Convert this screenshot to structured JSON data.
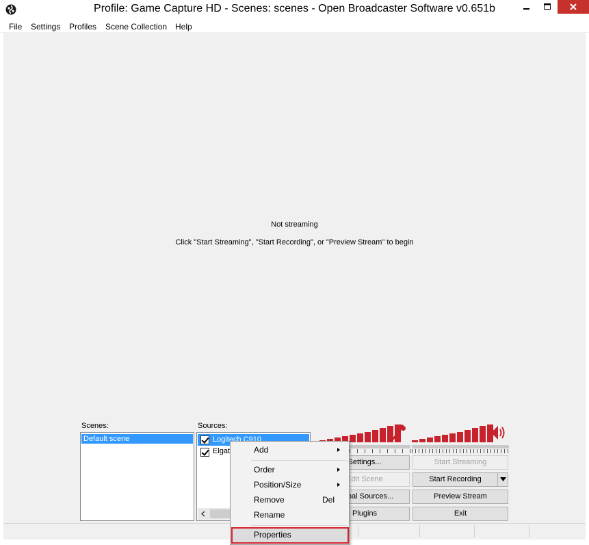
{
  "window": {
    "title": "Profile: Game Capture HD - Scenes: scenes - Open Broadcaster Software v0.651b"
  },
  "menu": [
    "File",
    "Settings",
    "Profiles",
    "Scene Collection",
    "Help"
  ],
  "preview": {
    "status": "Not streaming",
    "instruction": "Click \"Start Streaming\", \"Start Recording\", or \"Preview Stream\" to begin"
  },
  "scenes": {
    "label": "Scenes:",
    "items": [
      "Default scene"
    ]
  },
  "sources": {
    "label": "Sources:",
    "items": [
      {
        "label": "Logitech C910",
        "checked": true
      },
      {
        "label": "Elgato",
        "checked": true
      }
    ]
  },
  "meters": {
    "mic_icon": "microphone-icon",
    "speaker_icon": "speaker-icon",
    "accent": "#c8232c"
  },
  "buttons": {
    "settings": "Settings...",
    "edit_scene": "Edit Scene",
    "global_sources": "Global Sources...",
    "plugins": "Plugins",
    "start_streaming": "Start Streaming",
    "start_recording": "Start Recording",
    "preview_stream": "Preview Stream",
    "exit": "Exit"
  },
  "context_menu": {
    "add": "Add",
    "order": "Order",
    "position_size": "Position/Size",
    "remove": "Remove",
    "remove_shortcut": "Del",
    "rename": "Rename",
    "properties": "Properties"
  },
  "colors": {
    "titlebar_close": "#c7312b",
    "selection": "#3399ff",
    "highlight_box": "#d4202a"
  }
}
